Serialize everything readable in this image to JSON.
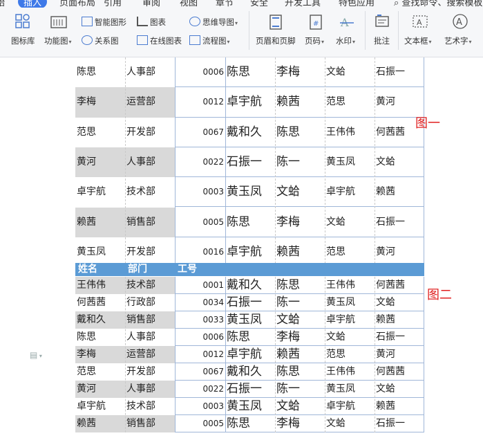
{
  "menu": {
    "items": [
      "插入",
      "页面布局",
      "引用",
      "审阅",
      "视图",
      "章节",
      "安全",
      "开发工具",
      "特色应用"
    ],
    "active": "插入",
    "search": "查找命令、搜索模板"
  },
  "toolbar": {
    "icon_lib": "图标库",
    "func_chart": "功能图",
    "smart_art": "智能图形",
    "chart": "图表",
    "mind_map": "思维导图",
    "relation": "关系图",
    "online_chart": "在线图表",
    "flowchart": "流程图",
    "header_footer": "页眉和页脚",
    "page_num": "页码",
    "watermark": "水印",
    "comment": "批注",
    "textbox": "文本框",
    "art_text": "艺术字"
  },
  "labels": {
    "fig1": "图一",
    "fig2": "图二"
  },
  "table1": {
    "rows": [
      {
        "name": "陈思",
        "dept": "人事部",
        "id": "0006",
        "c1": "陈思",
        "c2": "李梅",
        "c3": "文蛤",
        "c4": "石振一",
        "grey": false
      },
      {
        "name": "李梅",
        "dept": "运营部",
        "id": "0012",
        "c1": "卓宇航",
        "c2": "赖茜",
        "c3": "范思",
        "c4": "黄河",
        "grey": true
      },
      {
        "name": "范思",
        "dept": "开发部",
        "id": "0067",
        "c1": "戴和久",
        "c2": "陈思",
        "c3": "王伟伟",
        "c4": "何茜茜",
        "grey": false
      },
      {
        "name": "黄河",
        "dept": "人事部",
        "id": "0022",
        "c1": "石振一",
        "c2": "陈一",
        "c3": "黄玉凤",
        "c4": "文蛤",
        "grey": true
      },
      {
        "name": "卓宇航",
        "dept": "技术部",
        "id": "0003",
        "c1": "黄玉凤",
        "c2": "文蛤",
        "c3": "卓宇航",
        "c4": "赖茜",
        "grey": false
      },
      {
        "name": "赖茜",
        "dept": "销售部",
        "id": "0005",
        "c1": "陈思",
        "c2": "李梅",
        "c3": "文蛤",
        "c4": "石振一",
        "grey": true
      },
      {
        "name": "黄玉凤",
        "dept": "开发部",
        "id": "0016",
        "c1": "卓宇航",
        "c2": "赖茜",
        "c3": "范思",
        "c4": "黄河",
        "grey": false
      }
    ]
  },
  "table2": {
    "header": {
      "name": "姓名",
      "dept": "部门",
      "id": "工号"
    },
    "rows": [
      {
        "name": "王伟伟",
        "dept": "技术部",
        "id": "0001",
        "c1": "戴和久",
        "c2": "陈思",
        "c3": "王伟伟",
        "c4": "何茜茜",
        "grey": true
      },
      {
        "name": "何茜茜",
        "dept": "行政部",
        "id": "0034",
        "c1": "石振一",
        "c2": "陈一",
        "c3": "黄玉凤",
        "c4": "文蛤",
        "grey": false
      },
      {
        "name": "戴和久",
        "dept": "销售部",
        "id": "0033",
        "c1": "黄玉凤",
        "c2": "文蛤",
        "c3": "卓宇航",
        "c4": "赖茜",
        "grey": true
      },
      {
        "name": "陈思",
        "dept": "人事部",
        "id": "0006",
        "c1": "陈思",
        "c2": "李梅",
        "c3": "文蛤",
        "c4": "石振一",
        "grey": false
      },
      {
        "name": "李梅",
        "dept": "运营部",
        "id": "0012",
        "c1": "卓宇航",
        "c2": "赖茜",
        "c3": "范思",
        "c4": "黄河",
        "grey": true
      },
      {
        "name": "范思",
        "dept": "开发部",
        "id": "0067",
        "c1": "戴和久",
        "c2": "陈思",
        "c3": "王伟伟",
        "c4": "何茜茜",
        "grey": false
      },
      {
        "name": "黄河",
        "dept": "人事部",
        "id": "0022",
        "c1": "石振一",
        "c2": "陈一",
        "c3": "黄玉凤",
        "c4": "文蛤",
        "grey": true
      },
      {
        "name": "卓宇航",
        "dept": "技术部",
        "id": "0003",
        "c1": "黄玉凤",
        "c2": "文蛤",
        "c3": "卓宇航",
        "c4": "赖茜",
        "grey": false
      },
      {
        "name": "赖茜",
        "dept": "销售部",
        "id": "0005",
        "c1": "陈思",
        "c2": "李梅",
        "c3": "文蛤",
        "c4": "石振一",
        "grey": true
      }
    ]
  },
  "colors": {
    "accent": "#3e79e8",
    "header": "#5b9bd5",
    "grey": "#d9d9d9",
    "label": "#e02020",
    "grid": "#9fb6d8"
  }
}
